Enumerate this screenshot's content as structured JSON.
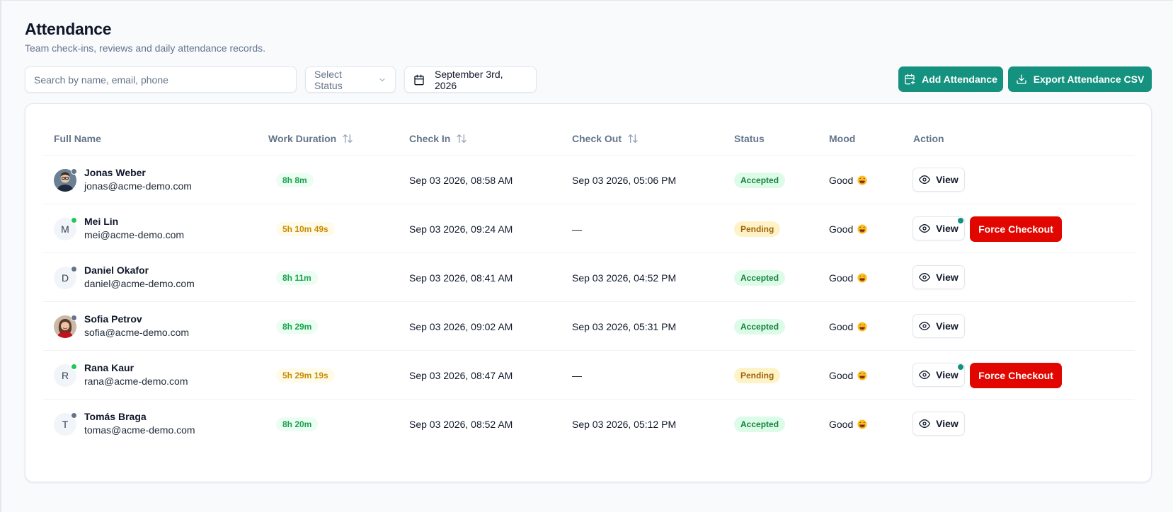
{
  "page": {
    "title": "Attendance",
    "subtitle": "Team check-ins, reviews and daily attendance records."
  },
  "toolbar": {
    "search_placeholder": "Search by name, email, phone",
    "status_select": "Select Status",
    "date": "September 3rd, 2026",
    "add_label": "Add Attendance",
    "export_label": "Export Attendance CSV"
  },
  "table": {
    "headers": {
      "name": "Full Name",
      "duration": "Work Duration",
      "check_in": "Check In",
      "check_out": "Check Out",
      "status": "Status",
      "mood": "Mood",
      "action": "Action"
    },
    "view_label": "View",
    "force_label": "Force Checkout",
    "rows": [
      {
        "name": "Jonas Weber",
        "email": "jonas@acme-demo.com",
        "initial": "",
        "presence": "offline",
        "duration": "8h 8m",
        "check_in": "Sep 03 2026, 08:58 AM",
        "check_out": "Sep 03 2026, 05:06 PM",
        "status": "Accepted",
        "mood": "Good"
      },
      {
        "name": "Mei Lin",
        "email": "mei@acme-demo.com",
        "initial": "M",
        "presence": "online",
        "duration": "5h 10m 49s",
        "check_in": "Sep 03 2026, 09:24 AM",
        "check_out": "—",
        "status": "Pending",
        "mood": "Good"
      },
      {
        "name": "Daniel Okafor",
        "email": "daniel@acme-demo.com",
        "initial": "D",
        "presence": "offline",
        "duration": "8h 11m",
        "check_in": "Sep 03 2026, 08:41 AM",
        "check_out": "Sep 03 2026, 04:52 PM",
        "status": "Accepted",
        "mood": "Good"
      },
      {
        "name": "Sofia Petrov",
        "email": "sofia@acme-demo.com",
        "initial": "",
        "presence": "offline",
        "duration": "8h 29m",
        "check_in": "Sep 03 2026, 09:02 AM",
        "check_out": "Sep 03 2026, 05:31 PM",
        "status": "Accepted",
        "mood": "Good"
      },
      {
        "name": "Rana Kaur",
        "email": "rana@acme-demo.com",
        "initial": "R",
        "presence": "online",
        "duration": "5h 29m 19s",
        "check_in": "Sep 03 2026, 08:47 AM",
        "check_out": "—",
        "status": "Pending",
        "mood": "Good"
      },
      {
        "name": "Tomás Braga",
        "email": "tomas@acme-demo.com",
        "initial": "T",
        "presence": "offline",
        "duration": "8h 20m",
        "check_in": "Sep 03 2026, 08:52 AM",
        "check_out": "Sep 03 2026, 05:12 PM",
        "status": "Accepted",
        "mood": "Good"
      }
    ]
  },
  "colors": {
    "accent": "#14917f",
    "danger": "#e10600",
    "online": "#22c55e",
    "offline": "#64748b"
  }
}
